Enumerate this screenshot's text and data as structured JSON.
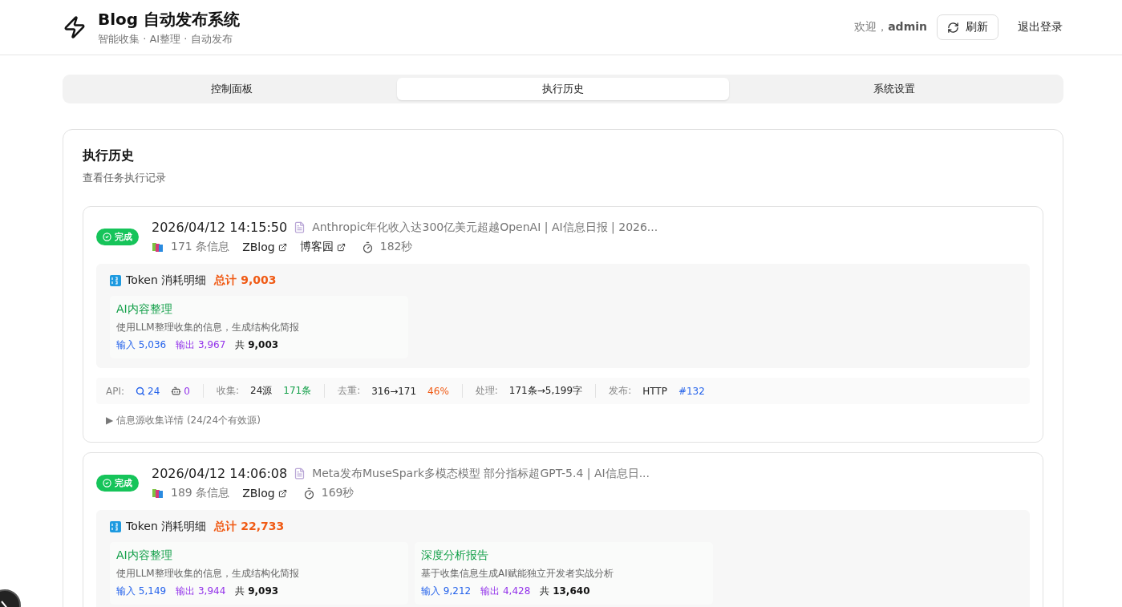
{
  "header": {
    "title": "Blog 自动发布系统",
    "subtitle": "智能收集 · AI整理 · 自动发布",
    "welcome": "欢迎，",
    "username": "admin",
    "refresh": "刷新",
    "logout": "退出登录"
  },
  "tabs": [
    {
      "label": "控制面板",
      "selected": false
    },
    {
      "label": "执行历史",
      "selected": true
    },
    {
      "label": "系统设置",
      "selected": false
    }
  ],
  "history": {
    "title": "执行历史",
    "subtitle": "查看任务执行记录",
    "records": [
      {
        "status": {
          "label": "完成",
          "kind": "done"
        },
        "time": "2026/04/12 14:15:50",
        "post_title": "Anthropic年化收入达300亿美元超越OpenAI | AI信息日报 | 2026...",
        "count": "171 条信息",
        "links": [
          "ZBlog",
          "博客园"
        ],
        "duration": "182秒",
        "token": {
          "label": "Token 消耗明细",
          "total": "总计 9,003",
          "tasks": [
            {
              "name": "AI内容整理",
              "desc": "使用LLM整理收集的信息，生成结构化简报",
              "input": "输入 5,036",
              "output": "输出 3,967",
              "sum_label": "共",
              "sum": "9,003"
            }
          ]
        },
        "stats": [
          {
            "label": "API:",
            "values": [
              {
                "text": "24",
                "color": "#2563eb"
              },
              {
                "text": "0",
                "color": "#9333ea"
              }
            ]
          },
          {
            "label": "收集:",
            "values": [
              {
                "text": "24源",
                "color": "#222222"
              },
              {
                "text": "171条",
                "color": "#14a04a"
              }
            ]
          },
          {
            "label": "去重:",
            "values": [
              {
                "text": "316→171",
                "color": "#222222"
              },
              {
                "text": "46%",
                "color": "#f05a14"
              }
            ]
          },
          {
            "label": "处理:",
            "values": [
              {
                "text": "171条→5,199字",
                "color": "#222222"
              }
            ]
          },
          {
            "label": "发布:",
            "values": [
              {
                "text": "HTTP",
                "color": "#222222"
              },
              {
                "text": "#132",
                "color": "#2563eb"
              }
            ]
          }
        ],
        "details": {
          "marker": "▶",
          "label": "信息源收集详情 (24/24个有效源)"
        }
      },
      {
        "status": {
          "label": "完成",
          "kind": "done"
        },
        "time": "2026/04/12 14:06:08",
        "post_title": "Meta发布MuseSpark多模态模型 部分指标超GPT-5.4 | AI信息日...",
        "count": "189 条信息",
        "links": [
          "ZBlog"
        ],
        "duration": "169秒",
        "token": {
          "label": "Token 消耗明细",
          "total": "总计 22,733",
          "tasks": [
            {
              "name": "AI内容整理",
              "desc": "使用LLM整理收集的信息，生成结构化简报",
              "input": "输入 5,149",
              "output": "输出 3,944",
              "sum_label": "共",
              "sum": "9,093"
            },
            {
              "name": "深度分析报告",
              "desc": "基于收集信息生成AI赋能独立开发者实战分析",
              "input": "输入 9,212",
              "output": "输出 4,428",
              "sum_label": "共",
              "sum": "13,640"
            }
          ]
        }
      }
    ]
  }
}
